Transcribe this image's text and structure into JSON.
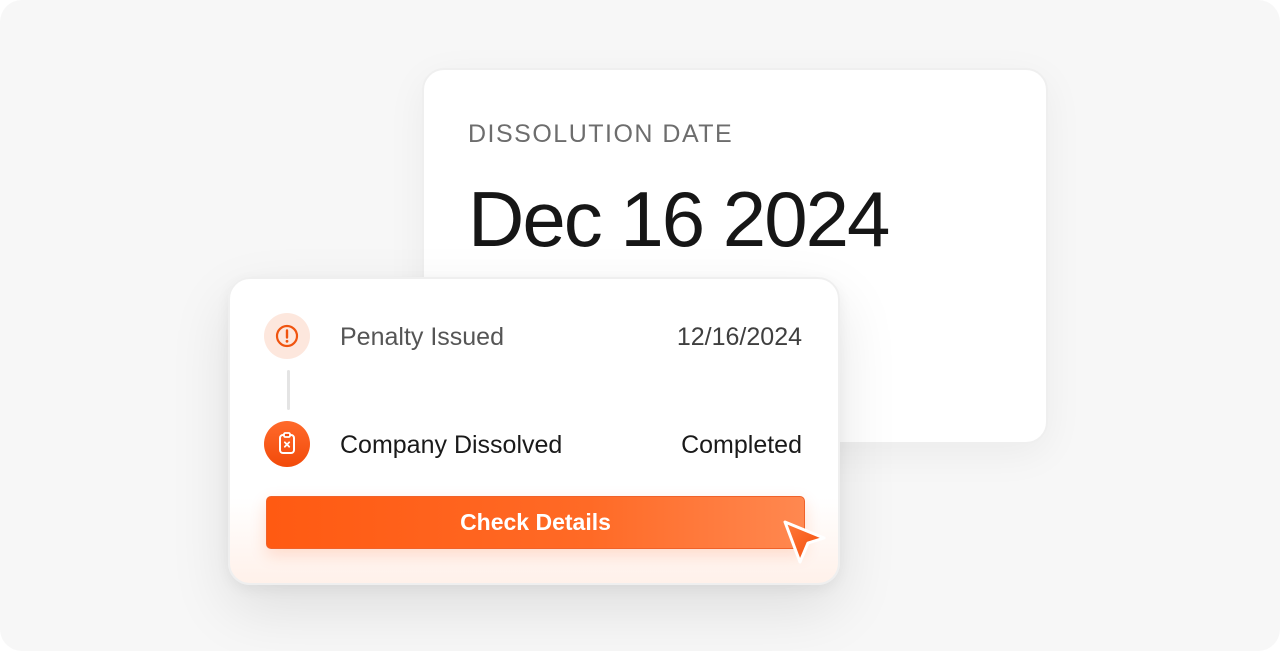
{
  "date_card": {
    "label": "DISSOLUTION DATE",
    "value": "Dec 16 2024"
  },
  "status_card": {
    "rows": [
      {
        "title": "Penalty Issued",
        "value": "12/16/2024",
        "icon": "alert-circle-icon"
      },
      {
        "title": "Company Dissolved",
        "value": "Completed",
        "icon": "clipboard-x-icon"
      }
    ],
    "button_label": "Check Details"
  },
  "colors": {
    "accent": "#ff5a12",
    "accent_light": "#fde7dd",
    "background": "#f7f7f7",
    "card": "#ffffff"
  },
  "cursor_icon": "pointer-arrow-icon"
}
